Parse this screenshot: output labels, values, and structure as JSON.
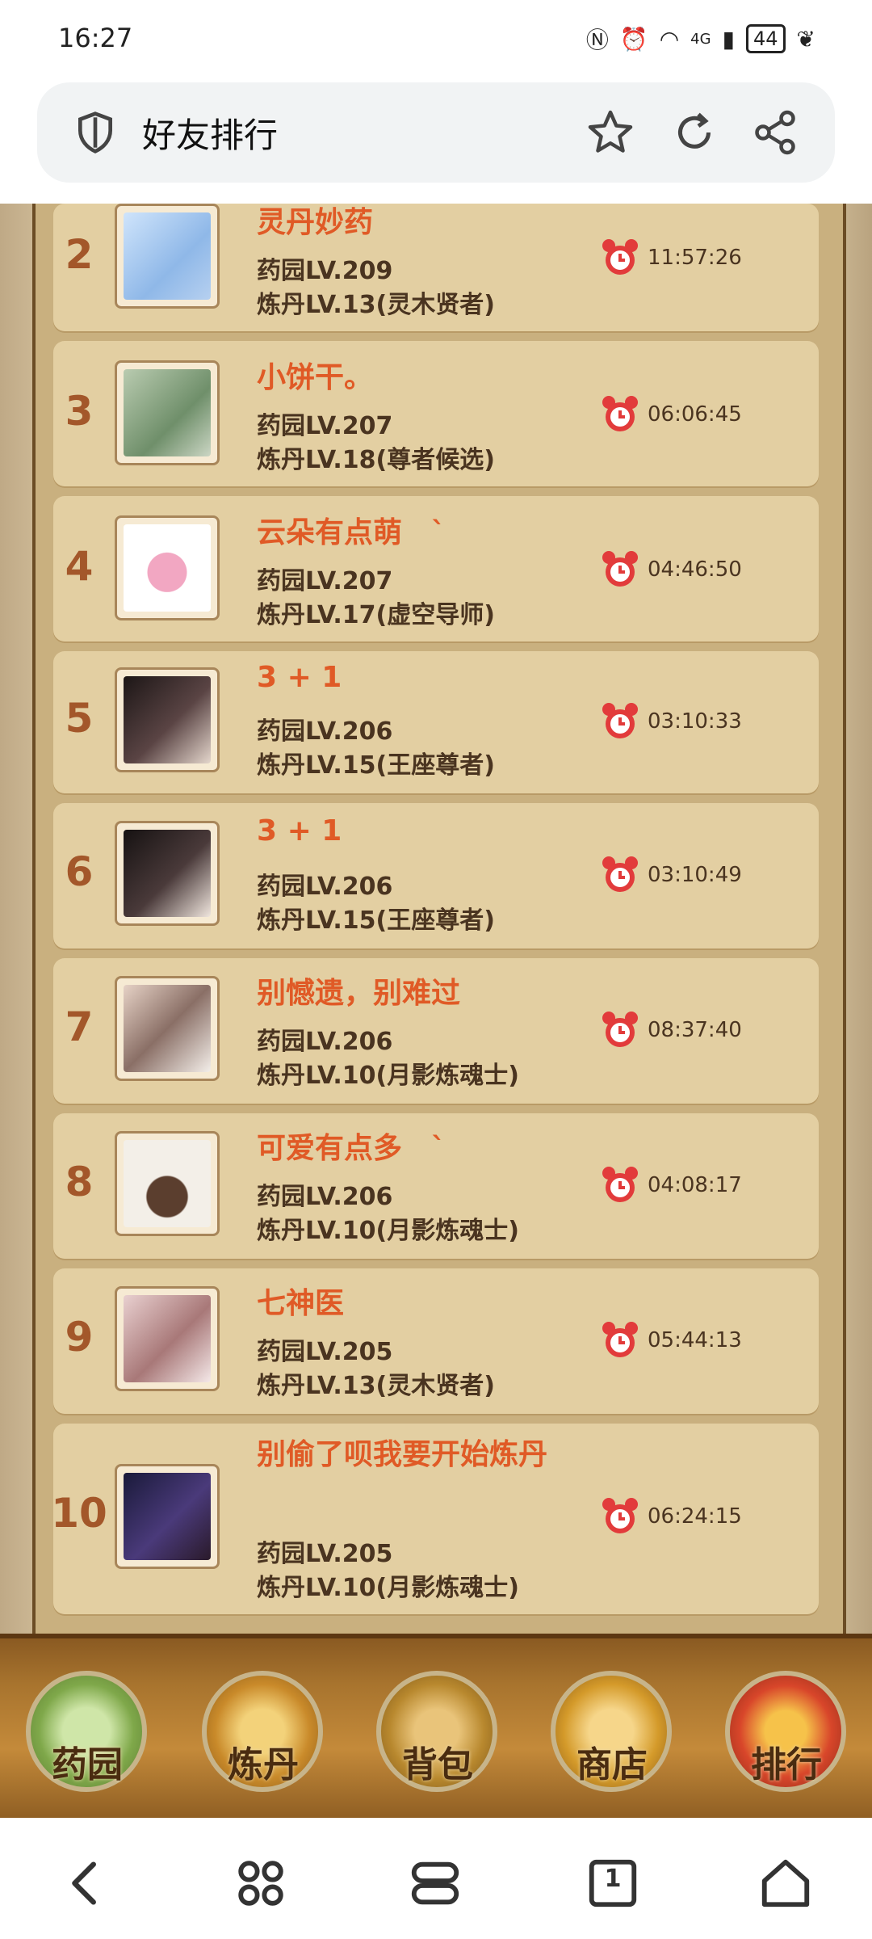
{
  "status_bar": {
    "time": "16:27",
    "network": "4G",
    "battery": "44"
  },
  "address_bar": {
    "title": "好友排行"
  },
  "ranking": [
    {
      "rank": "2",
      "name": "灵丹妙药",
      "garden": "药园LV.209",
      "alchemy": "炼丹LV.13(灵木贤者)",
      "time": "11:57:26",
      "avatar_color": "#8fb8e8"
    },
    {
      "rank": "3",
      "name": "小饼干。",
      "garden": "药园LV.207",
      "alchemy": "炼丹LV.18(尊者候选)",
      "time": "06:06:45",
      "avatar_color": "#7d9b7a"
    },
    {
      "rank": "4",
      "name": "云朵有点萌　ˋ",
      "garden": "药园LV.207",
      "alchemy": "炼丹LV.17(虚空导师)",
      "time": "04:46:50",
      "avatar_color": "#f2b8cc"
    },
    {
      "rank": "5",
      "name": "3 + 1",
      "garden": "药园LV.206",
      "alchemy": "炼丹LV.15(王座尊者)",
      "time": "03:10:33",
      "avatar_color": "#3a2a2a"
    },
    {
      "rank": "6",
      "name": "  3 + 1",
      "garden": "药园LV.206",
      "alchemy": "炼丹LV.15(王座尊者)",
      "time": "03:10:49",
      "avatar_color": "#2c2222"
    },
    {
      "rank": "7",
      "name": "别憾遗，别难过",
      "garden": "药园LV.206",
      "alchemy": "炼丹LV.10(月影炼魂士)",
      "time": "08:37:40",
      "avatar_color": "#c9a89c"
    },
    {
      "rank": "8",
      "name": "可爱有点多　ˋ",
      "garden": "药园LV.206",
      "alchemy": "炼丹LV.10(月影炼魂士)",
      "time": "04:08:17",
      "avatar_color": "#e9e4dc"
    },
    {
      "rank": "9",
      "name": "七神医",
      "garden": "药园LV.205",
      "alchemy": "炼丹LV.13(灵木贤者)",
      "time": "05:44:13",
      "avatar_color": "#c7a0a0"
    },
    {
      "rank": "10",
      "name": "别偷了呗我要开始炼丹",
      "garden": "药园LV.205",
      "alchemy": "炼丹LV.10(月影炼魂士)",
      "time": "06:24:15",
      "avatar_color": "#2a2a4a"
    }
  ],
  "menu": [
    {
      "label": "药园",
      "icon": "garden-icon",
      "color": "#7fa84a"
    },
    {
      "label": "炼丹",
      "icon": "alchemy-cauldron-icon",
      "color": "#c98a2a"
    },
    {
      "label": "背包",
      "icon": "backpack-icon",
      "color": "#b8882e"
    },
    {
      "label": "商店",
      "icon": "shop-chest-icon",
      "color": "#d49a2a"
    },
    {
      "label": "排行",
      "icon": "ranking-icon",
      "color": "#d8462a"
    }
  ],
  "nav": {
    "tabs_count": "1"
  }
}
